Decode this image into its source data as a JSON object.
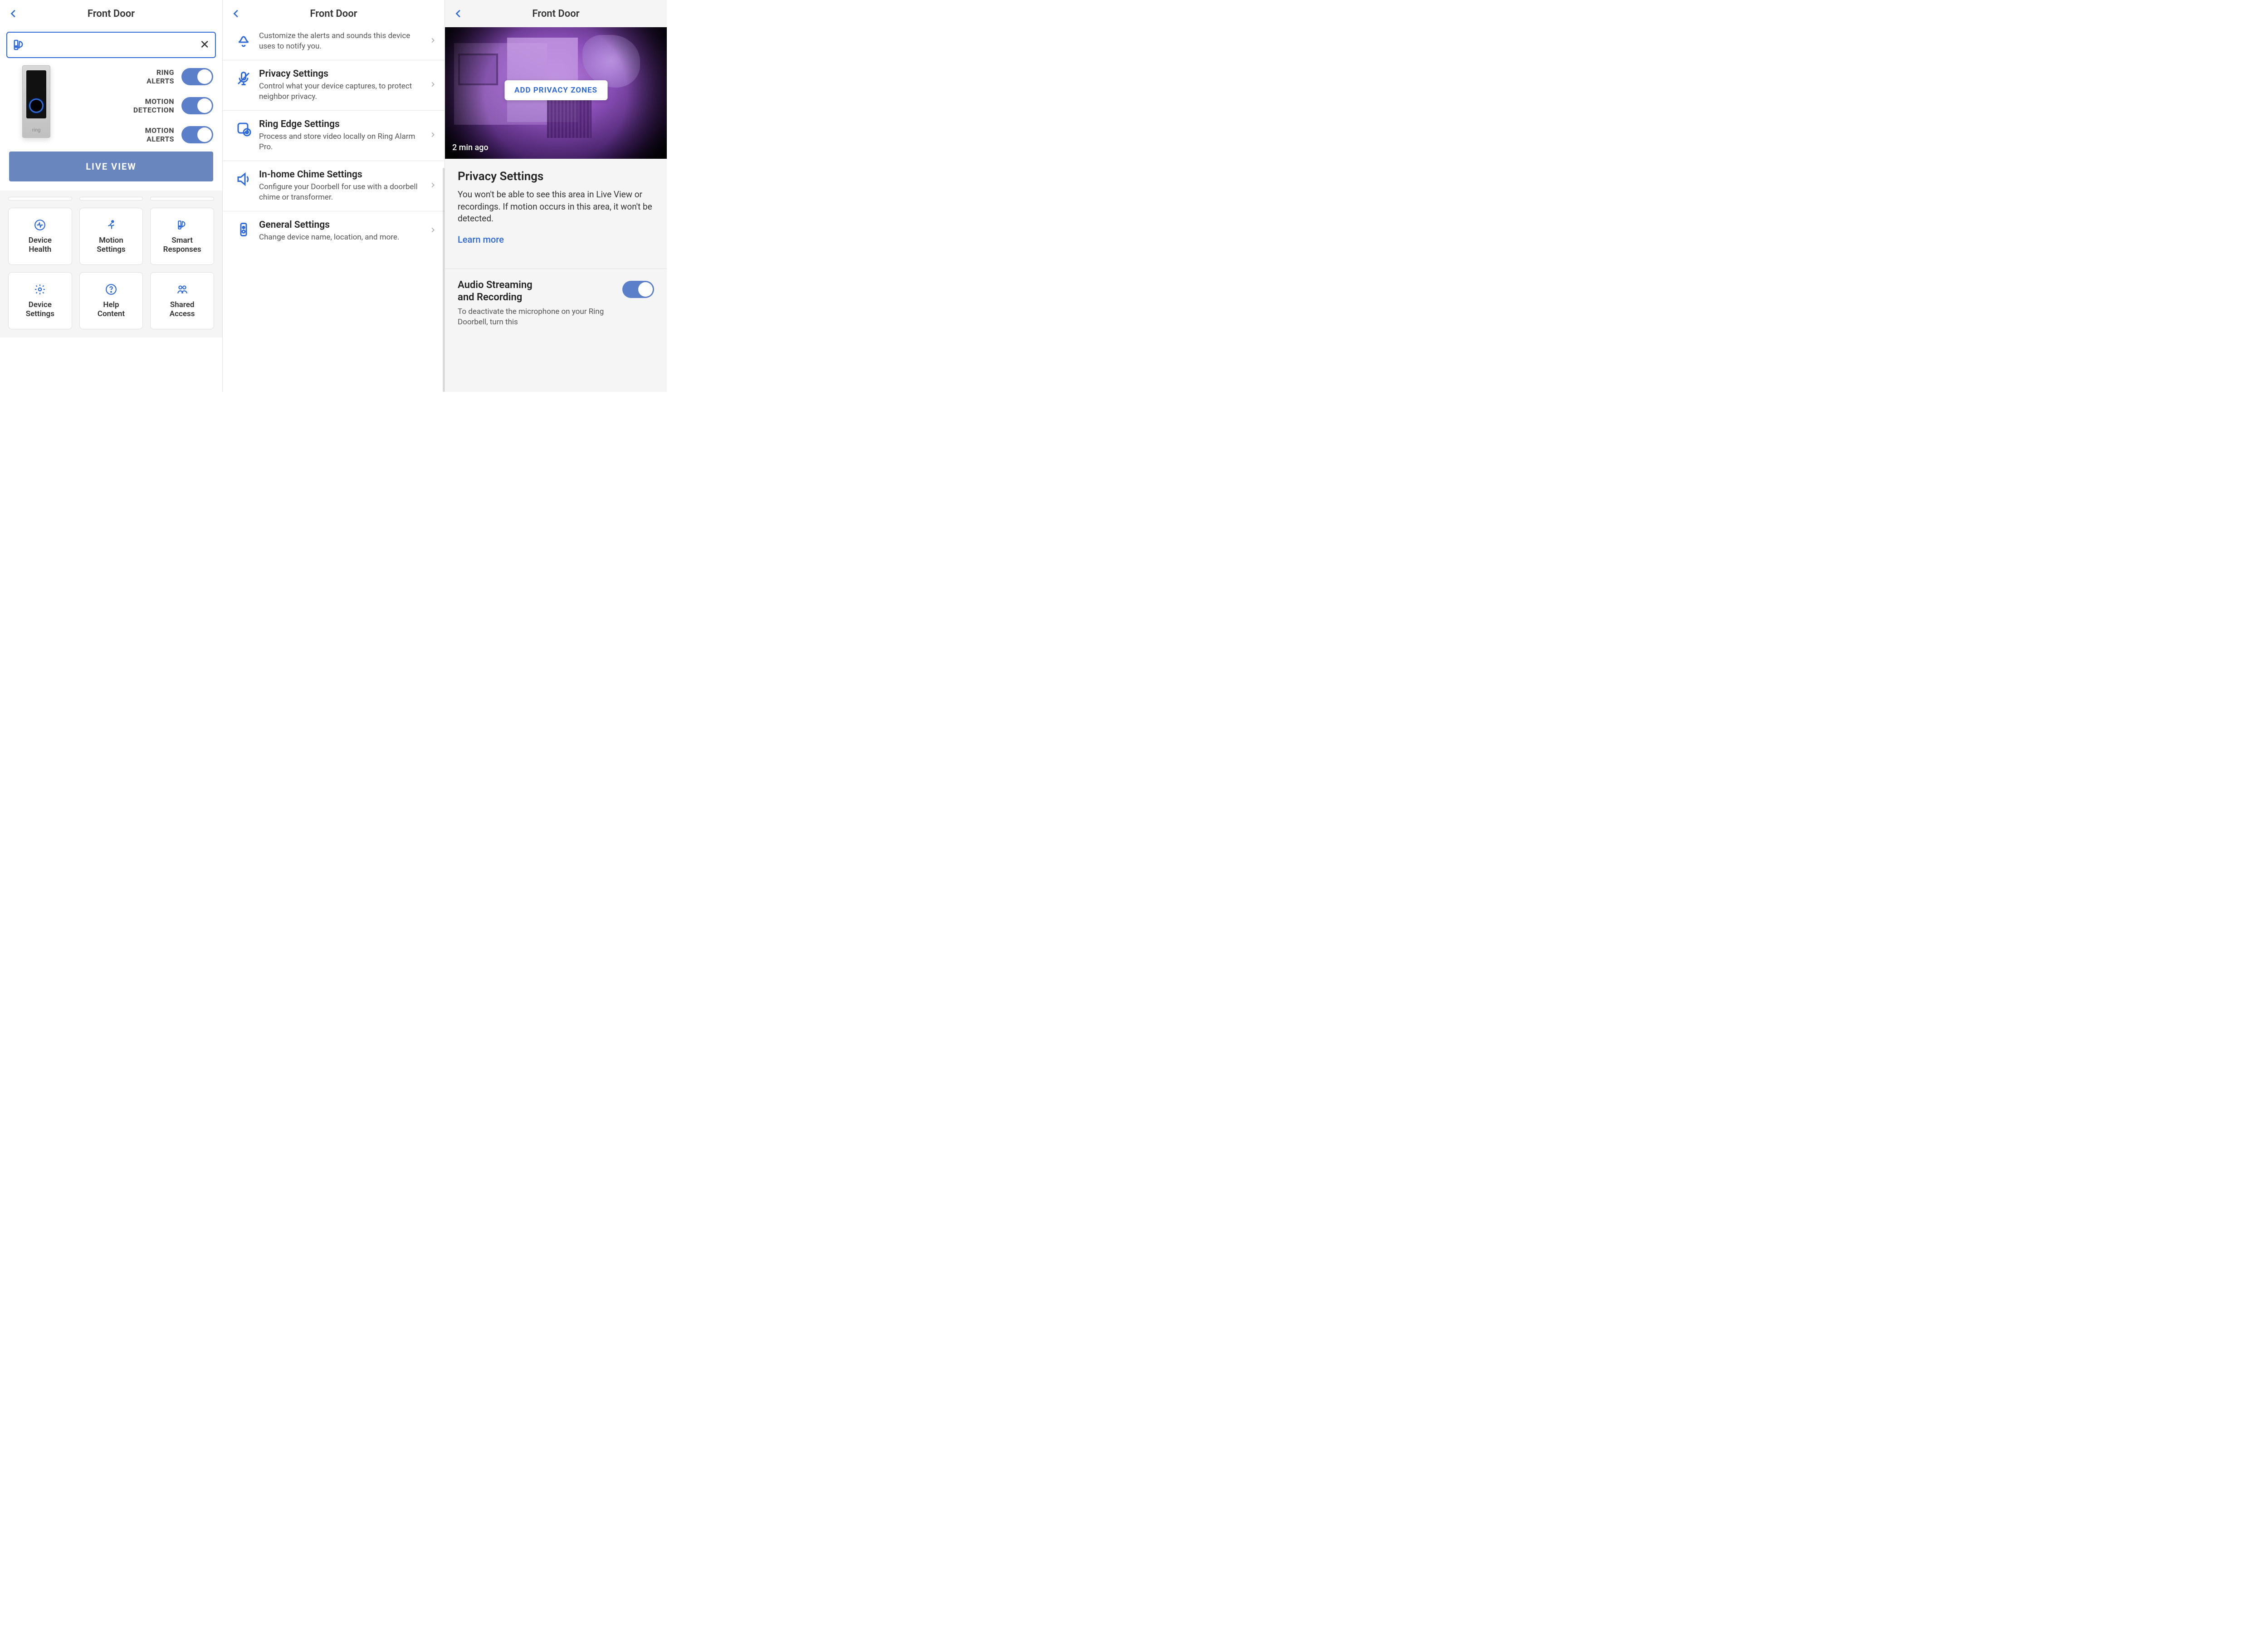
{
  "panel1": {
    "title": "Front Door",
    "search_value": "",
    "toggles": {
      "ring_alerts": {
        "label": "RING\nALERTS",
        "on": true
      },
      "motion_detection": {
        "label": "MOTION\nDETECTION",
        "on": true
      },
      "motion_alerts": {
        "label": "MOTION\nALERTS",
        "on": true
      }
    },
    "live_view_label": "LIVE VIEW",
    "tiles": [
      {
        "id": "device-health",
        "label": "Device\nHealth"
      },
      {
        "id": "motion-settings",
        "label": "Motion\nSettings"
      },
      {
        "id": "smart-responses",
        "label": "Smart\nResponses"
      },
      {
        "id": "device-settings",
        "label": "Device\nSettings"
      },
      {
        "id": "help-content",
        "label": "Help\nContent"
      },
      {
        "id": "shared-access",
        "label": "Shared\nAccess"
      }
    ]
  },
  "panel2": {
    "title": "Front Door",
    "rows": [
      {
        "id": "alerts",
        "title": "",
        "desc": "Customize the alerts and sounds this device uses to notify you."
      },
      {
        "id": "privacy",
        "title": "Privacy Settings",
        "desc": "Control what your device captures, to protect neighbor privacy."
      },
      {
        "id": "edge",
        "title": "Ring Edge Settings",
        "desc": "Process and store video locally on Ring Alarm Pro."
      },
      {
        "id": "chime",
        "title": "In-home Chime Settings",
        "desc": "Configure your Doorbell for use with a doorbell chime or transformer."
      },
      {
        "id": "general",
        "title": "General Settings",
        "desc": "Change device name, location, and more."
      }
    ]
  },
  "panel3": {
    "title": "Front Door",
    "camera_timestamp": "2 min ago",
    "add_zone_label": "ADD PRIVACY ZONES",
    "section_title": "Privacy Settings",
    "section_desc": "You won't be able to see this area in Live View or recordings. If motion occurs in this area, it won't be detected.",
    "learn_more": "Learn more",
    "audio_toggle": {
      "title": "Audio Streaming\nand Recording",
      "desc": "To deactivate the microphone on your Ring Doorbell, turn this",
      "on": true
    }
  }
}
